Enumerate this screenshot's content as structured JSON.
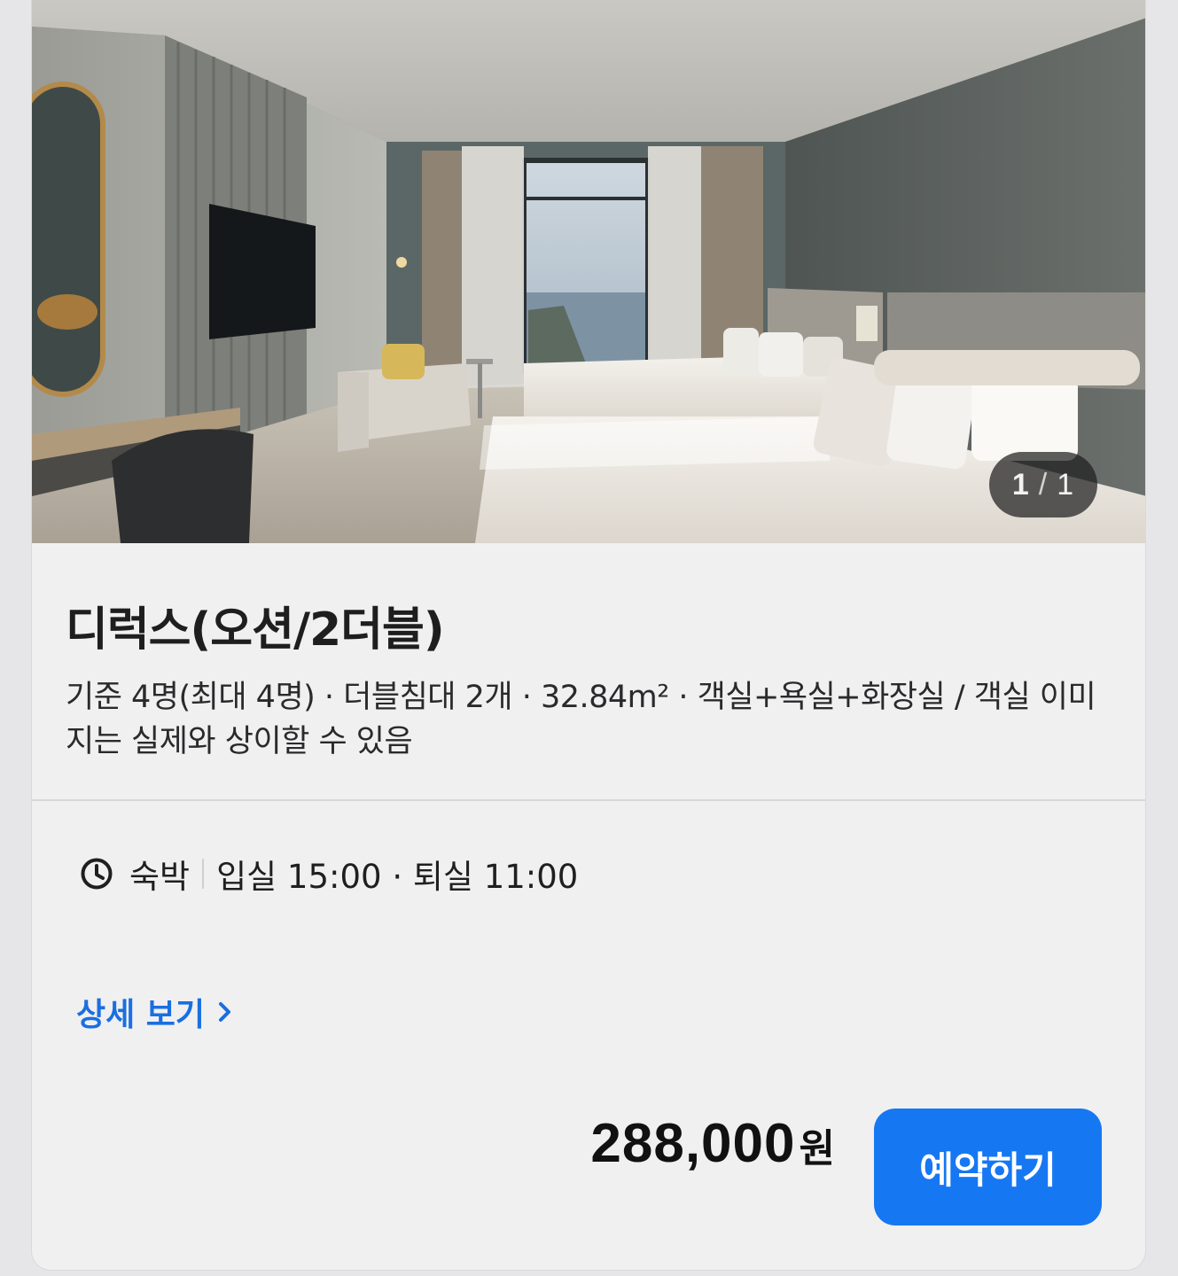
{
  "photo": {
    "current": "1",
    "separator": "/",
    "total": "1"
  },
  "room": {
    "title": "디럭스(오션/2더블)",
    "description": "기준 4명(최대 4명) · 더블침대 2개 · 32.84m² · 객실+욕실+화장실 / 객실 이미지는 실제와 상이할 수 있음"
  },
  "stay": {
    "type": "숙박",
    "times": "입실 15:00 · 퇴실 11:00"
  },
  "links": {
    "detail_label": "상세 보기"
  },
  "pricing": {
    "amount": "288,000",
    "unit": "원"
  },
  "actions": {
    "book_label": "예약하기"
  },
  "colors": {
    "accent": "#1677f2",
    "link": "#1a6fe0"
  }
}
